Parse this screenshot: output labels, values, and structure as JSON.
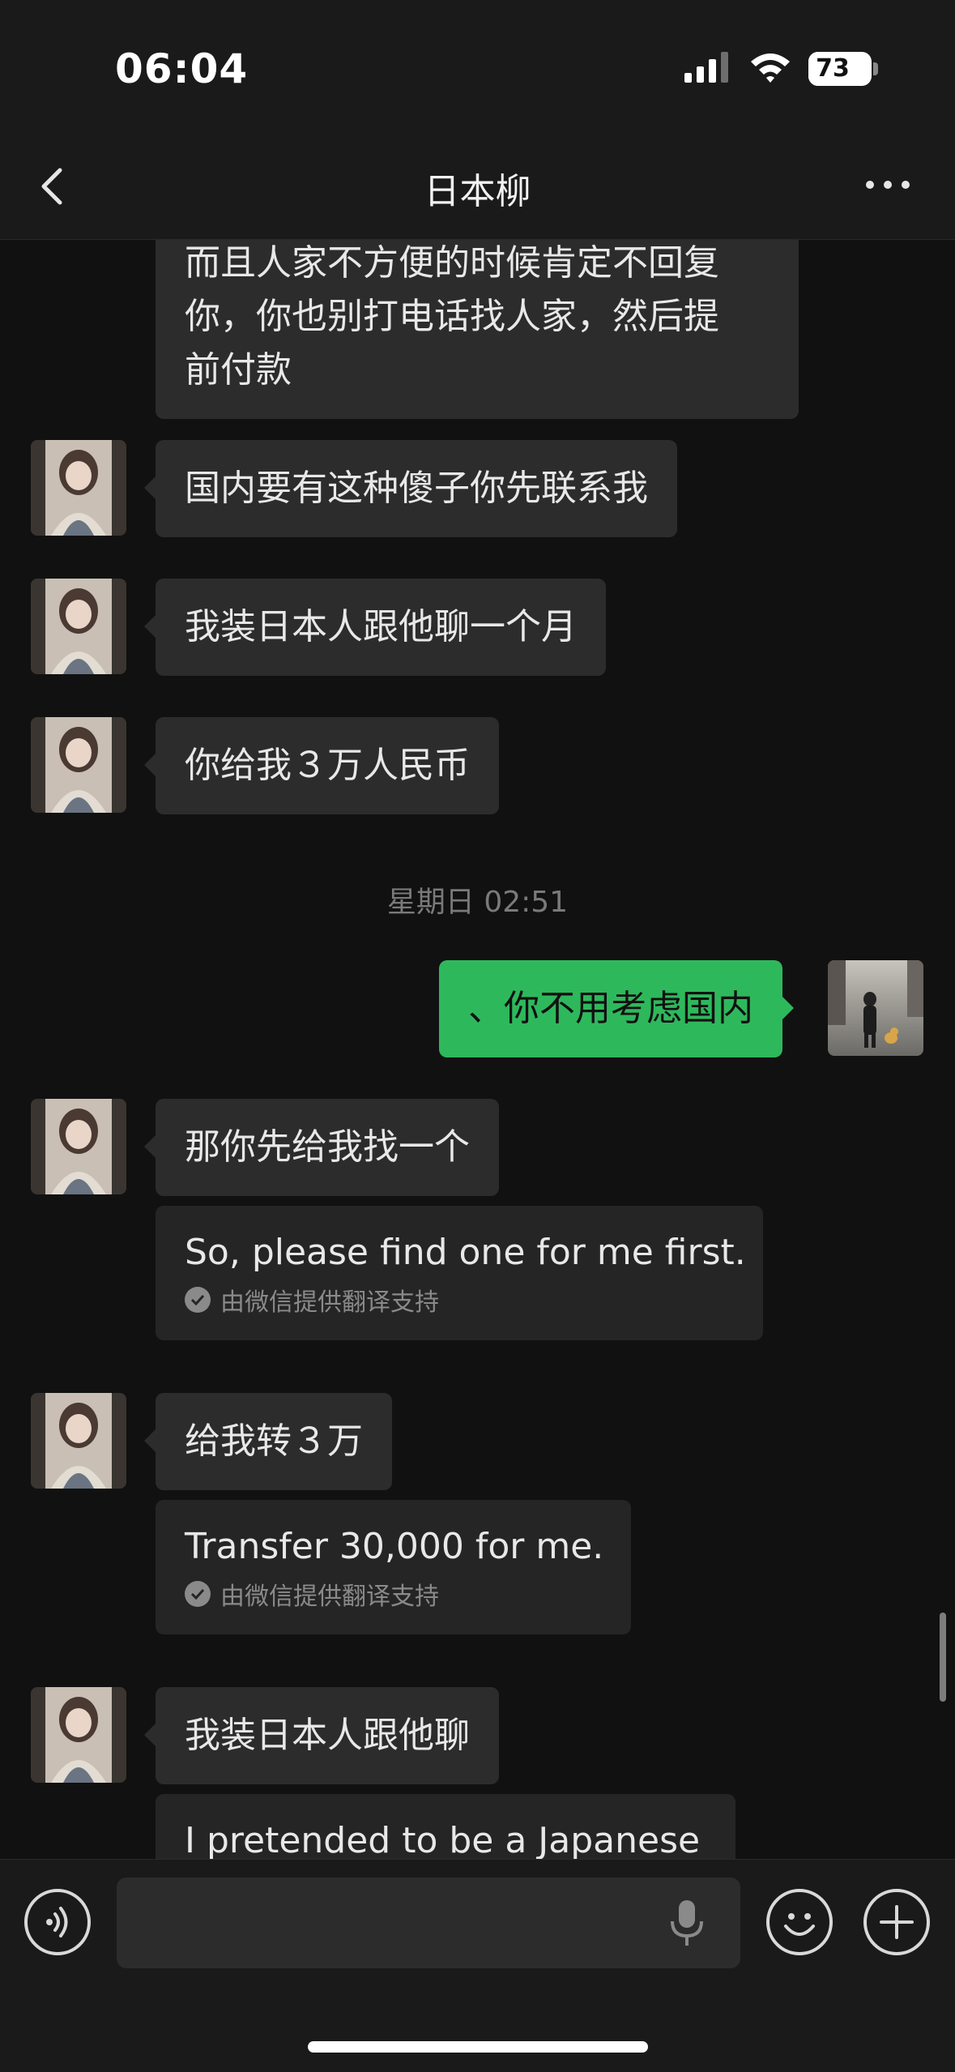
{
  "status_bar": {
    "time": "06:04",
    "battery": "73"
  },
  "header": {
    "title": "日本柳"
  },
  "messages": [
    {
      "side": "left",
      "lines": [
        "而且人家不方便的时候肯定不回复",
        "你，你也别打电话找人家，然后提",
        "前付款"
      ]
    },
    {
      "side": "left",
      "text": "国内要有这种傻子你先联系我"
    },
    {
      "side": "left",
      "text": "我装日本人跟他聊一个月"
    },
    {
      "side": "left",
      "text": "你给我３万人民币"
    },
    {
      "timestamp": "星期日 02:51"
    },
    {
      "side": "right",
      "text": "、你不用考虑国内"
    },
    {
      "side": "left",
      "text": "那你先给我找一个",
      "translation": "So, please find one for me first.",
      "translation_note": "由微信提供翻译支持"
    },
    {
      "side": "left",
      "text": "给我转３万",
      "translation": "Transfer 30,000 for me.",
      "translation_note": "由微信提供翻译支持"
    },
    {
      "side": "left",
      "text": "我装日本人跟他聊",
      "translation": "I pretended to be a Japanese"
    }
  ],
  "input": {
    "placeholder": ""
  },
  "colors": {
    "background": "#111111",
    "bubble_other": "#2c2c2c",
    "bubble_self": "#2eb85c",
    "bar": "#1a1a1a"
  },
  "icons": [
    "back-chevron-icon",
    "more-dots-icon",
    "voice-icon",
    "microphone-icon",
    "emoji-icon",
    "plus-icon"
  ]
}
